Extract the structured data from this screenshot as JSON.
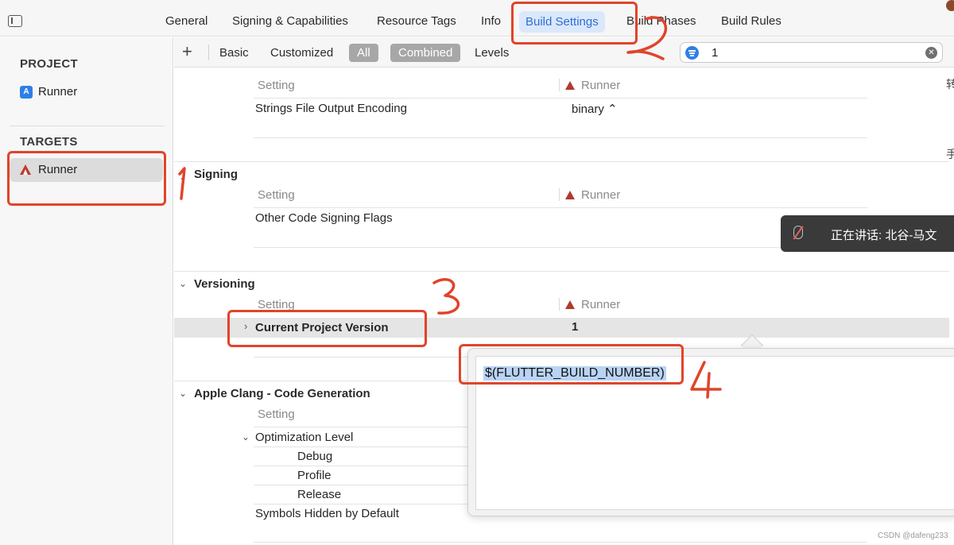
{
  "tabs": {
    "general": "General",
    "signing": "Signing & Capabilities",
    "resource_tags": "Resource Tags",
    "info": "Info",
    "build_settings": "Build Settings",
    "build_phases": "Build Phases",
    "build_rules": "Build Rules"
  },
  "navigator": {
    "project_heading": "PROJECT",
    "project_item": "Runner",
    "targets_heading": "TARGETS",
    "target_item": "Runner"
  },
  "filterbar": {
    "add": "+",
    "basic": "Basic",
    "customized": "Customized",
    "all": "All",
    "combined": "Combined",
    "levels": "Levels",
    "search_value": "1"
  },
  "settings": {
    "col_setting": "Setting",
    "col_runner": "Runner",
    "localization": {
      "row_strings_encoding": "Strings File Output Encoding",
      "val_strings_encoding": "binary ⌃"
    },
    "signing": {
      "title": "Signing",
      "row_other_flags": "Other Code Signing Flags"
    },
    "versioning": {
      "title": "Versioning",
      "row_current_version": "Current Project Version",
      "val_current_version": "1"
    },
    "clang": {
      "title": "Apple Clang - Code Generation",
      "row_optimization": "Optimization Level",
      "row_debug": "Debug",
      "row_profile": "Profile",
      "row_release": "Release",
      "row_symbols_hidden": "Symbols Hidden by Default"
    }
  },
  "popover": {
    "value": "$(FLUTTER_BUILD_NUMBER)"
  },
  "toast": {
    "text": "正在讲话: 北谷-马文"
  },
  "edge": {
    "frag1": "转",
    "frag2": "手"
  },
  "watermark": "CSDN @dafeng233",
  "colors": {
    "accent_blue": "#2f6fd6",
    "annotation_red": "#e0442a",
    "selection_gray": "#e5e5e5"
  }
}
